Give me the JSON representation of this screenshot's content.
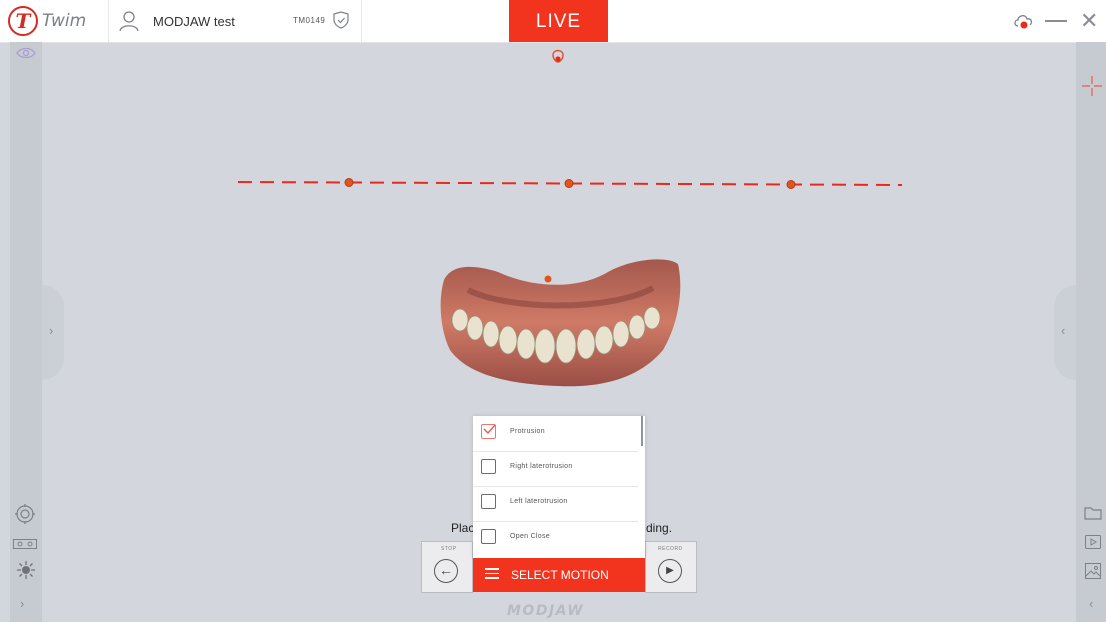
{
  "app": {
    "logo_letter": "T",
    "name": "Twim",
    "patient_name": "MODJAW test",
    "patient_id": "TM0149",
    "live_label": "LIVE"
  },
  "colors": {
    "accent": "#f2341e",
    "background": "#d3d7dd",
    "marker": "#e0541d"
  },
  "motions": {
    "items": [
      {
        "label": "Protrusion",
        "checked": true
      },
      {
        "label": "Right laterotrusion",
        "checked": false
      },
      {
        "label": "Left laterotrusion",
        "checked": false
      },
      {
        "label": "Open Close",
        "checked": false
      }
    ],
    "select_label": "SELECT MOTION"
  },
  "controls": {
    "stop_label": "STOP",
    "record_label": "RECORD",
    "instruction_left": "Plac",
    "instruction_right": "ding."
  },
  "footer": {
    "brand": "MODJAW"
  },
  "icons": {
    "left_sidebar": [
      "eye-icon",
      "target-icon",
      "cameras-icon",
      "light-icon",
      "chevron-right-icon"
    ],
    "right_sidebar": [
      "crosshair-icon",
      "folder-icon",
      "play-file-icon",
      "image-icon",
      "chevron-left-icon"
    ]
  }
}
